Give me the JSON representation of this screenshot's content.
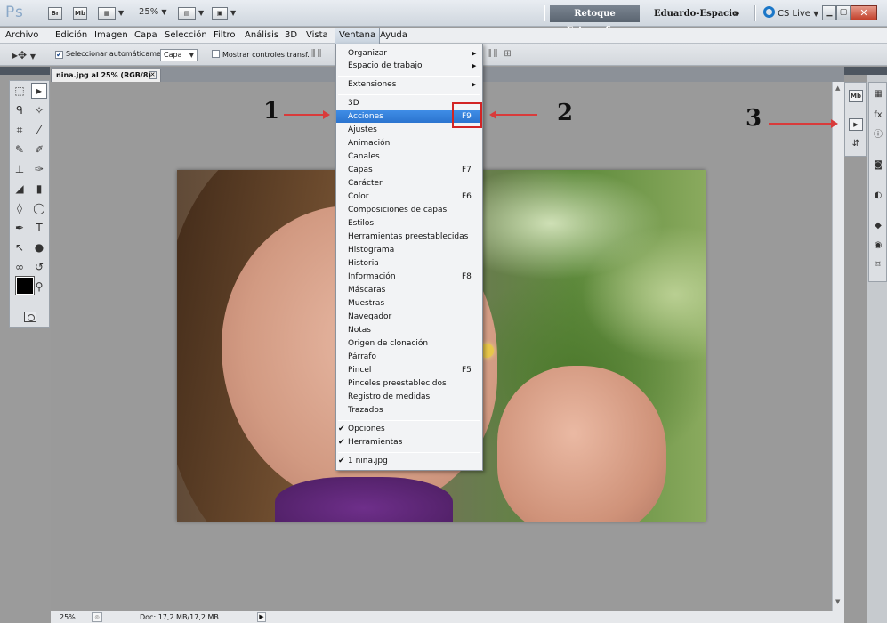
{
  "app": {
    "logo": "Ps",
    "bridge_label": "Br",
    "minibridge_label": "Mb",
    "zoom": "25%",
    "workspaces": {
      "active": "Retoque Fotografico",
      "other": "Eduardo-Espacio",
      "more": "»"
    },
    "cs_live": "CS Live"
  },
  "menubar": {
    "items": [
      "Archivo",
      "Edición",
      "Imagen",
      "Capa",
      "Selección",
      "Filtro",
      "Análisis",
      "3D",
      "Vista",
      "Ventana",
      "Ayuda"
    ],
    "active": "Ventana"
  },
  "options": {
    "auto_select_label": "Seleccionar automáticamente:",
    "auto_select_value": "Capa",
    "transform_label": "Mostrar controles transf."
  },
  "document": {
    "tab_title": "nina.jpg al 25% (RGB/8)"
  },
  "status": {
    "zoom": "25%",
    "doc_info": "Doc: 17,2 MB/17,2 MB"
  },
  "ventana_menu": {
    "top": [
      {
        "label": "Organizar",
        "submenu": true
      },
      {
        "label": "Espacio de trabajo",
        "submenu": true
      }
    ],
    "extensions": {
      "label": "Extensiones",
      "submenu": true
    },
    "panels": [
      {
        "label": "3D",
        "shortcut": ""
      },
      {
        "label": "Acciones",
        "shortcut": "F9",
        "highlighted": true
      },
      {
        "label": "Ajustes",
        "shortcut": ""
      },
      {
        "label": "Animación",
        "shortcut": ""
      },
      {
        "label": "Canales",
        "shortcut": ""
      },
      {
        "label": "Capas",
        "shortcut": "F7"
      },
      {
        "label": "Carácter",
        "shortcut": ""
      },
      {
        "label": "Color",
        "shortcut": "F6"
      },
      {
        "label": "Composiciones de capas",
        "shortcut": ""
      },
      {
        "label": "Estilos",
        "shortcut": ""
      },
      {
        "label": "Herramientas preestablecidas",
        "shortcut": ""
      },
      {
        "label": "Histograma",
        "shortcut": ""
      },
      {
        "label": "Historia",
        "shortcut": ""
      },
      {
        "label": "Información",
        "shortcut": "F8"
      },
      {
        "label": "Máscaras",
        "shortcut": ""
      },
      {
        "label": "Muestras",
        "shortcut": ""
      },
      {
        "label": "Navegador",
        "shortcut": ""
      },
      {
        "label": "Notas",
        "shortcut": ""
      },
      {
        "label": "Origen de clonación",
        "shortcut": ""
      },
      {
        "label": "Párrafo",
        "shortcut": ""
      },
      {
        "label": "Pincel",
        "shortcut": "F5"
      },
      {
        "label": "Pinceles preestablecidos",
        "shortcut": ""
      },
      {
        "label": "Registro de medidas",
        "shortcut": ""
      },
      {
        "label": "Trazados",
        "shortcut": ""
      }
    ],
    "toggles": [
      {
        "label": "Opciones",
        "checked": true
      },
      {
        "label": "Herramientas",
        "checked": true
      }
    ],
    "open_docs": [
      {
        "label": "1 nina.jpg",
        "checked": true
      }
    ]
  },
  "annotations": [
    "1",
    "2",
    "3"
  ]
}
